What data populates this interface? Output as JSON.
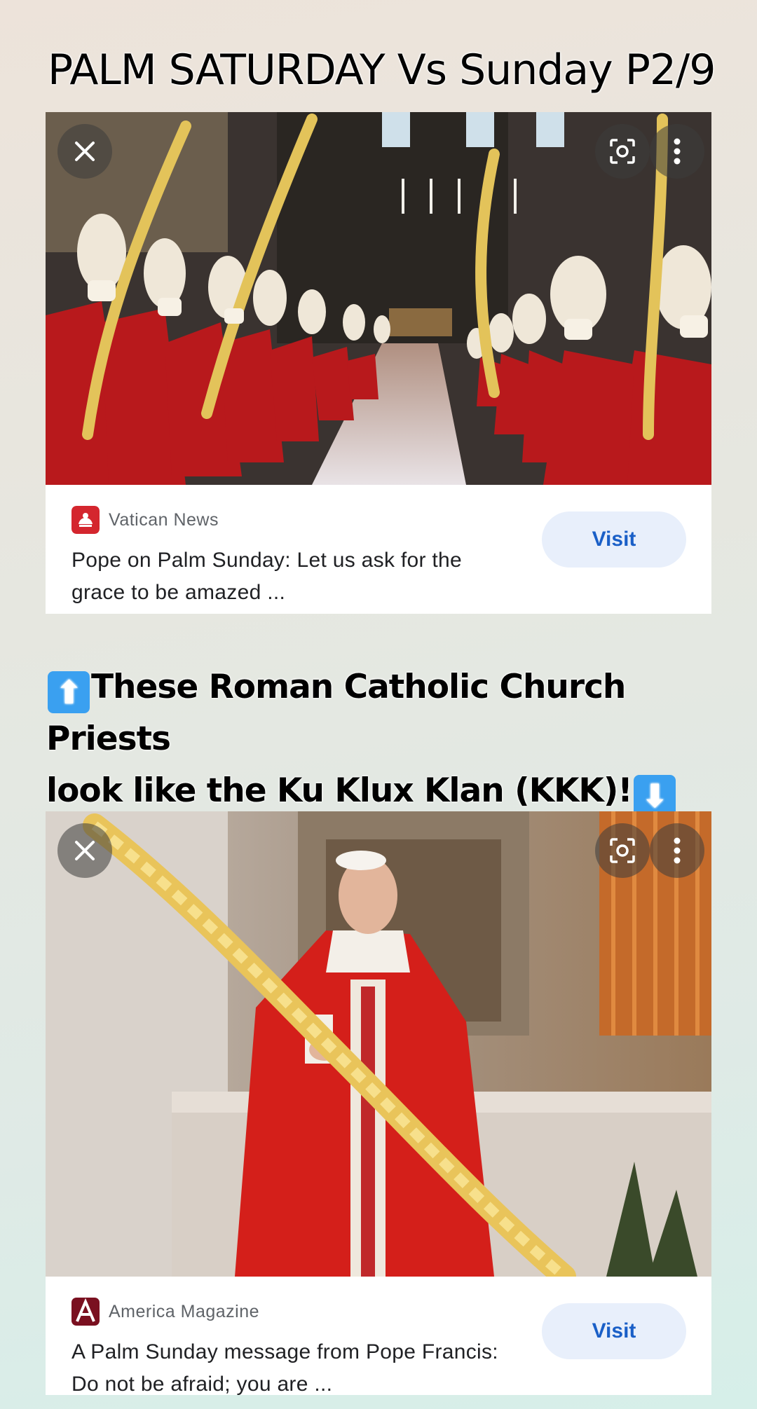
{
  "post": {
    "title": "PALM SATURDAY Vs Sunday P2/9",
    "caption_line1": "These Roman Catholic Church Priests",
    "caption_line2": "look like the Ku Klux Klan (KKK)!",
    "emoji_up": "⬆",
    "emoji_down": "⬇"
  },
  "results": [
    {
      "source": "Vatican News",
      "headline": "Pope on Palm Sunday: Let us ask for the grace to be amazed ...",
      "visit_label": "Visit",
      "image_subject": "Procession of bishops in red vestments and white mitres holding palm fronds in St. Peter's Basilica"
    },
    {
      "source": "America Magazine",
      "headline": "A Palm Sunday message from Pope Francis: Do not be afraid; you are ...",
      "visit_label": "Visit",
      "image_subject": "Pope Francis in red vestments holding a braided palm frond"
    }
  ],
  "icons": {
    "close": "close-icon",
    "lens": "lens-icon",
    "more": "more-vert-icon"
  },
  "colors": {
    "visit_bg": "#e8effb",
    "visit_text": "#1a5fc7",
    "vatican_logo": "#d4262e",
    "america_logo": "#7a1020"
  }
}
